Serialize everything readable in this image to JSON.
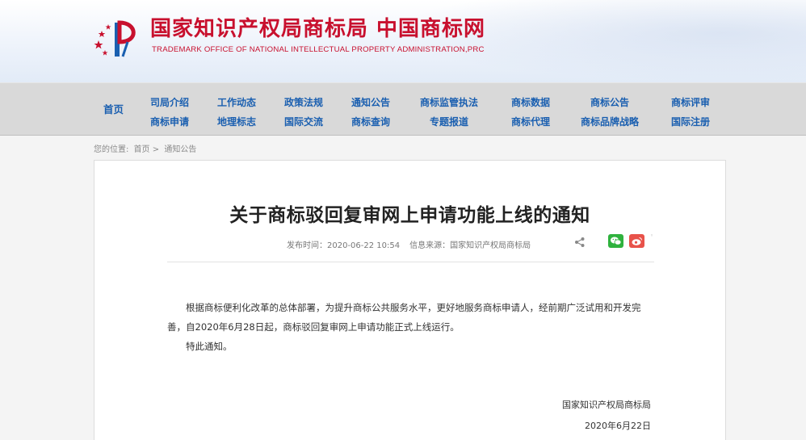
{
  "header": {
    "title_left": "国家知识产权局商标局",
    "title_right": "中国商标网",
    "subtitle": "TRADEMARK OFFICE OF NATIONAL INTELLECTUAL PROPERTY ADMINISTRATION,PRC",
    "brand_color": "#c8102e"
  },
  "nav": {
    "home": "首页",
    "columns": [
      {
        "top": "司局介绍",
        "bottom": "商标申请"
      },
      {
        "top": "工作动态",
        "bottom": "地理标志"
      },
      {
        "top": "政策法规",
        "bottom": "国际交流"
      },
      {
        "top": "通知公告",
        "bottom": "商标查询"
      },
      {
        "top": "商标监管执法",
        "bottom": "专题报道"
      },
      {
        "top": "商标数据",
        "bottom": "商标代理"
      },
      {
        "top": "商标公告",
        "bottom": "商标品牌战略"
      },
      {
        "top": "商标评审",
        "bottom": "国际注册"
      }
    ],
    "link_color": "#1a5fb0"
  },
  "breadcrumb": {
    "label": "您的位置:",
    "home": "首页",
    "separator": ">",
    "current": "通知公告"
  },
  "article": {
    "title": "关于商标驳回复审网上申请功能上线的通知",
    "publish_time": "发布时间：2020-06-22 10:54",
    "source": "信息来源：国家知识产权局商标局",
    "paragraphs": [
      "根据商标便利化改革的总体部署，为提升商标公共服务水平，更好地服务商标申请人，经前期广泛试用和开发完善，自2020年6月28日起，商标驳回复审网上申请功能正式上线运行。",
      "特此通知。"
    ],
    "signer": "国家知识产权局商标局",
    "date": "2020年6月22日"
  },
  "share": {
    "icons": [
      "share-icon",
      "wechat-icon",
      "weibo-icon"
    ],
    "wechat_color": "#2fb23e",
    "weibo_color": "#e8524a"
  }
}
